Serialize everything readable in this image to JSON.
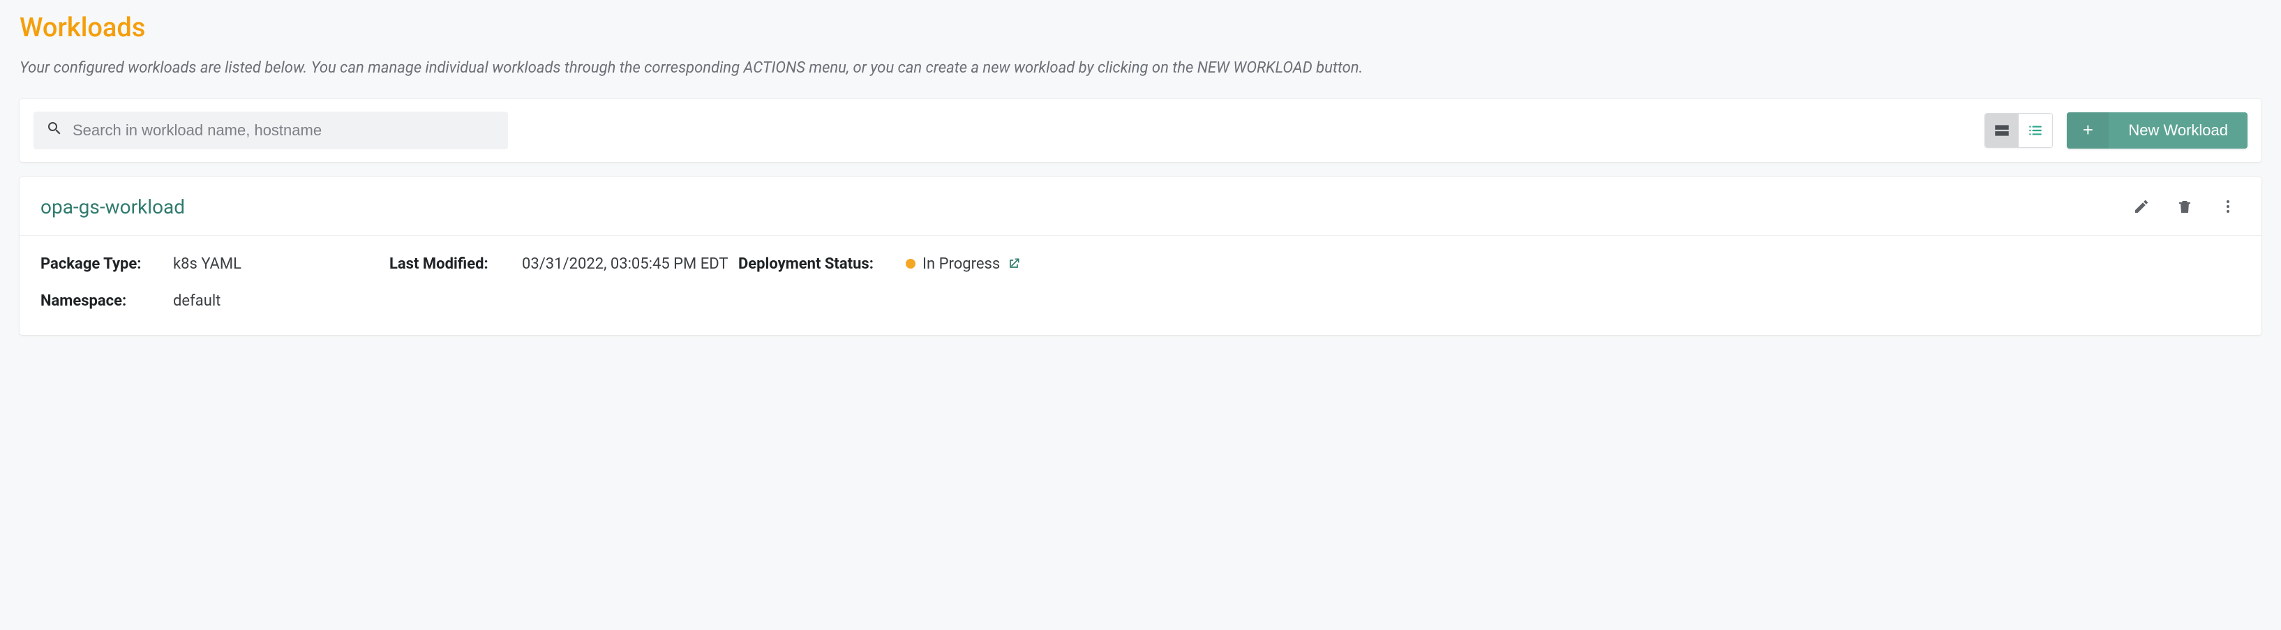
{
  "page": {
    "title": "Workloads",
    "subtitle": "Your configured workloads are listed below. You can manage individual workloads through the corresponding ACTIONS menu, or you can create a new workload by clicking on the NEW WORKLOAD button."
  },
  "toolbar": {
    "search_placeholder": "Search in workload name, hostname",
    "new_workload_label": "New Workload"
  },
  "workload": {
    "name": "opa-gs-workload",
    "package_type_label": "Package Type:",
    "package_type_value": "k8s YAML",
    "namespace_label": "Namespace:",
    "namespace_value": "default",
    "last_modified_label": "Last Modified:",
    "last_modified_value": "03/31/2022, 03:05:45 PM EDT",
    "deployment_status_label": "Deployment Status:",
    "deployment_status_value": "In Progress"
  }
}
